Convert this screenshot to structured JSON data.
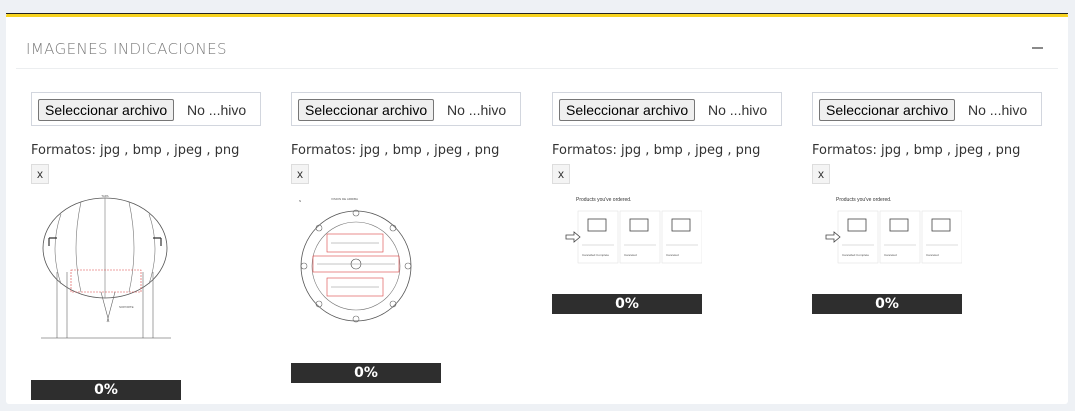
{
  "panel": {
    "title": "IMAGENES INDICACIONES",
    "accent_color": "#f7d31f",
    "collapse_icon": "minus-icon"
  },
  "uploads": [
    {
      "button_label": "Seleccionar archivo",
      "file_name": "No ...hivo",
      "formats": "Formatos: jpg , bmp , jpeg , png",
      "remove_label": "x",
      "image": "technical-drawing-sphere",
      "progress": 0,
      "progress_label": "0%"
    },
    {
      "button_label": "Seleccionar archivo",
      "file_name": "No ...hivo",
      "formats": "Formatos: jpg , bmp , jpeg , png",
      "remove_label": "x",
      "image": "technical-drawing-circle-plan",
      "progress": 0,
      "progress_label": "0%"
    },
    {
      "button_label": "Seleccionar archivo",
      "file_name": "No ...hivo",
      "formats": "Formatos: jpg , bmp , jpeg , png",
      "remove_label": "x",
      "image": "products-screenshot",
      "image_caption": "Products you've ordered.",
      "product_labels": [
        "Cancelled Complete",
        "Canceled",
        "Canceled"
      ],
      "progress": 0,
      "progress_label": "0%"
    },
    {
      "button_label": "Seleccionar archivo",
      "file_name": "No ...hivo",
      "formats": "Formatos: jpg , bmp , jpeg , png",
      "remove_label": "x",
      "image": "products-screenshot",
      "image_caption": "Products you've ordered.",
      "product_labels": [
        "Cancelled Complete",
        "Canceled",
        "Canceled"
      ],
      "progress": 0,
      "progress_label": "0%"
    }
  ]
}
